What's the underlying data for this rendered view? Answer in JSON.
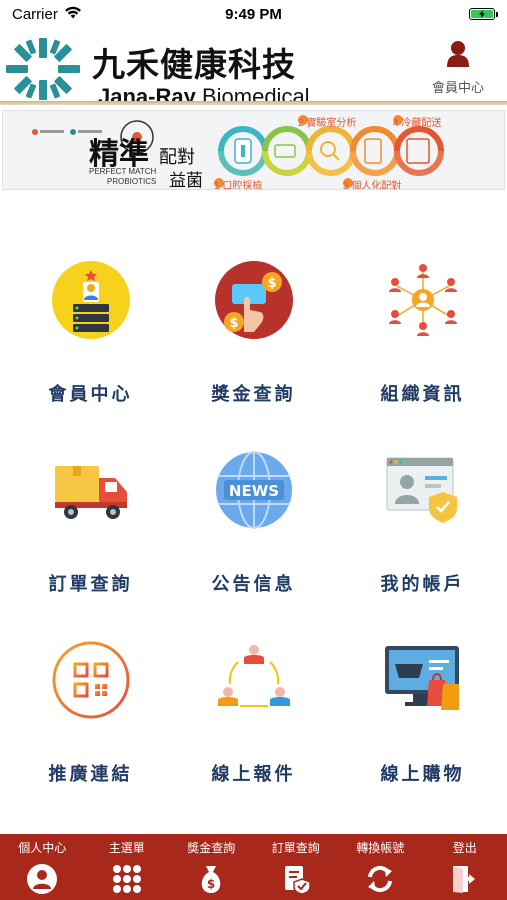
{
  "status_bar": {
    "carrier": "Carrier",
    "time": "9:49 PM"
  },
  "header": {
    "brand_cn": "九禾健康科技",
    "brand_en_bold": "Jana-Ray",
    "brand_en_rest": " Biomedical",
    "member_label": "會員中心"
  },
  "banner": {
    "title_main": "精準",
    "title_side_top": "配對",
    "title_side_bottom": "益菌",
    "subtitle_1": "PERFECT MATCH",
    "subtitle_2": "PROBIOTICS",
    "steps": [
      {
        "label": "1 口腔採檢"
      },
      {
        "label": "2 實驗室分析"
      },
      {
        "label": "3 個人化配對"
      },
      {
        "label": "4 冷藏配送"
      }
    ]
  },
  "grid": [
    {
      "label": "會員中心",
      "icon": "member-server-icon"
    },
    {
      "label": "獎金查詢",
      "icon": "bonus-coin-icon"
    },
    {
      "label": "組織資訊",
      "icon": "organization-network-icon"
    },
    {
      "label": "訂單查詢",
      "icon": "delivery-truck-icon"
    },
    {
      "label": "公告信息",
      "icon": "news-globe-icon"
    },
    {
      "label": "我的帳戶",
      "icon": "account-card-icon"
    },
    {
      "label": "推廣連結",
      "icon": "qr-code-icon"
    },
    {
      "label": "線上報件",
      "icon": "online-report-icon"
    },
    {
      "label": "線上購物",
      "icon": "shopping-screen-icon"
    }
  ],
  "tabbar": [
    {
      "label": "個人中心",
      "icon": "person-icon"
    },
    {
      "label": "主選單",
      "icon": "grid-dots-icon"
    },
    {
      "label": "獎金查詢",
      "icon": "money-bag-icon"
    },
    {
      "label": "訂單查詢",
      "icon": "order-check-icon"
    },
    {
      "label": "轉換帳號",
      "icon": "refresh-icon"
    },
    {
      "label": "登出",
      "icon": "logout-icon"
    }
  ],
  "colors": {
    "tabbar_bg": "#a8281b",
    "label_text": "#1f3b66",
    "logo_teal": "#2a8f96"
  }
}
